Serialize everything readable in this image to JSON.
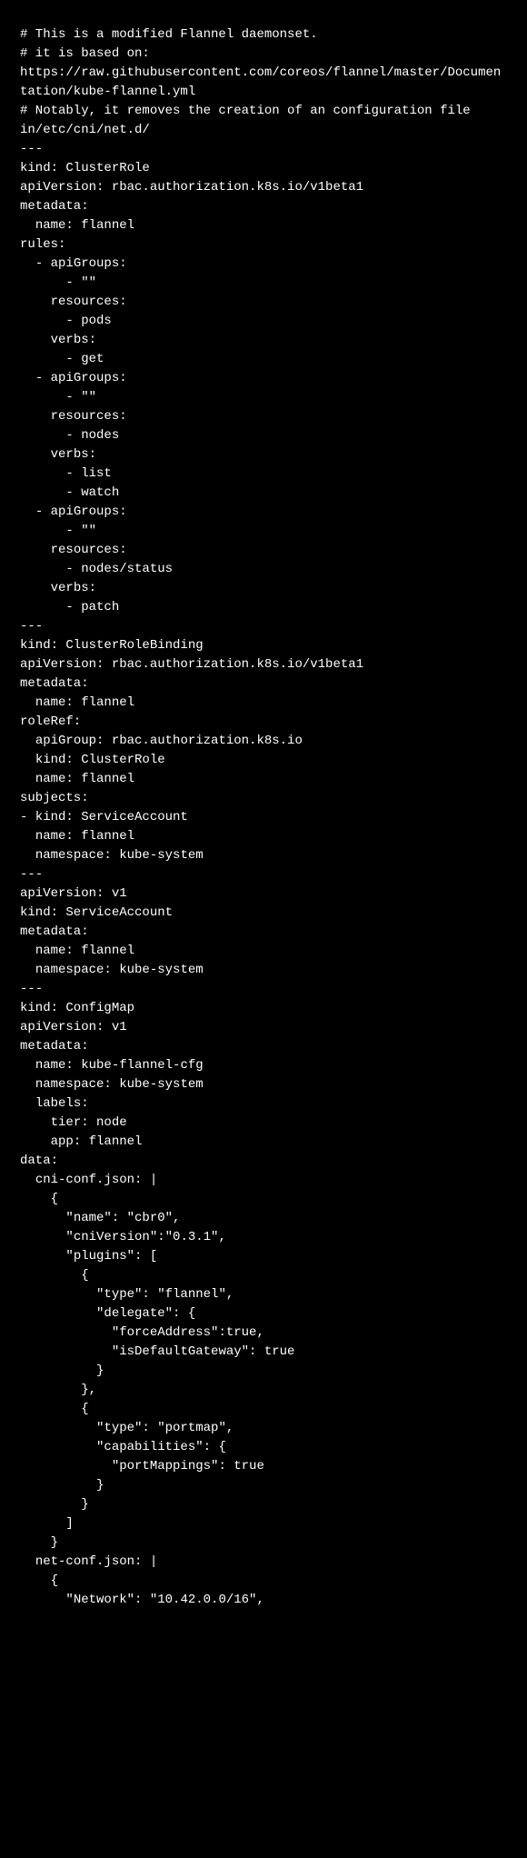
{
  "code": {
    "lines": [
      "# This is a modified Flannel daemonset.",
      "# it is based on: https://raw.githubusercontent.com/coreos/flannel/master/Documentation/kube-flannel.yml",
      "# Notably, it removes the creation of an configuration file in/etc/cni/net.d/",
      "---",
      "kind: ClusterRole",
      "apiVersion: rbac.authorization.k8s.io/v1beta1",
      "metadata:",
      "  name: flannel",
      "rules:",
      "  - apiGroups:",
      "      - \"\"",
      "    resources:",
      "      - pods",
      "    verbs:",
      "      - get",
      "  - apiGroups:",
      "      - \"\"",
      "    resources:",
      "      - nodes",
      "    verbs:",
      "      - list",
      "      - watch",
      "  - apiGroups:",
      "      - \"\"",
      "    resources:",
      "      - nodes/status",
      "    verbs:",
      "      - patch",
      "---",
      "kind: ClusterRoleBinding",
      "apiVersion: rbac.authorization.k8s.io/v1beta1",
      "metadata:",
      "  name: flannel",
      "roleRef:",
      "  apiGroup: rbac.authorization.k8s.io",
      "  kind: ClusterRole",
      "  name: flannel",
      "subjects:",
      "- kind: ServiceAccount",
      "  name: flannel",
      "  namespace: kube-system",
      "---",
      "apiVersion: v1",
      "kind: ServiceAccount",
      "metadata:",
      "  name: flannel",
      "  namespace: kube-system",
      "---",
      "kind: ConfigMap",
      "apiVersion: v1",
      "metadata:",
      "  name: kube-flannel-cfg",
      "  namespace: kube-system",
      "  labels:",
      "    tier: node",
      "    app: flannel",
      "data:",
      "  cni-conf.json: |",
      "    {",
      "      \"name\": \"cbr0\",",
      "      \"cniVersion\":\"0.3.1\",",
      "      \"plugins\": [",
      "        {",
      "          \"type\": \"flannel\",",
      "          \"delegate\": {",
      "            \"forceAddress\":true,",
      "            \"isDefaultGateway\": true",
      "          }",
      "        },",
      "        {",
      "          \"type\": \"portmap\",",
      "          \"capabilities\": {",
      "            \"portMappings\": true",
      "          }",
      "        }",
      "      ]",
      "    }",
      "  net-conf.json: |",
      "    {",
      "      \"Network\": \"10.42.0.0/16\","
    ]
  }
}
